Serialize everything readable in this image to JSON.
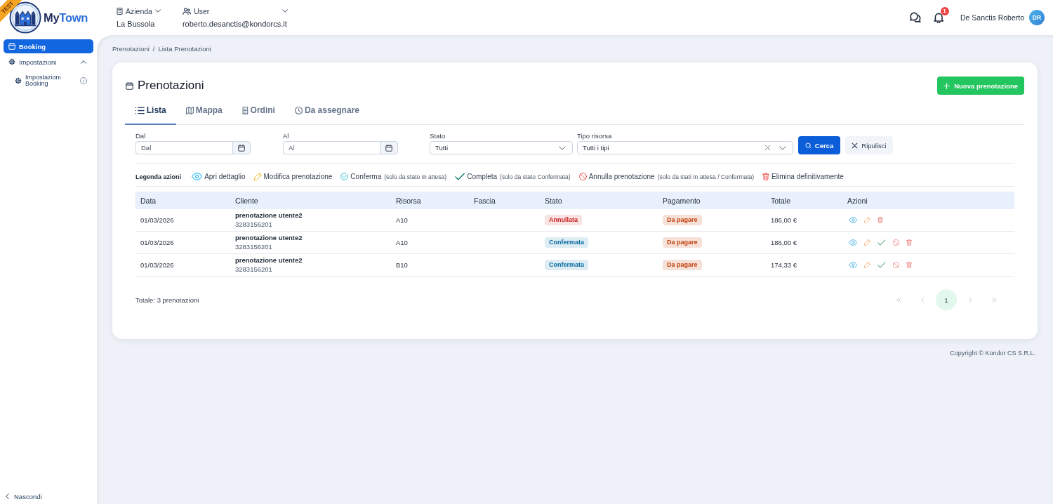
{
  "env_badge": "TEST",
  "logo": {
    "prefix": "My",
    "suffix": "Town"
  },
  "header": {
    "company": {
      "label": "Azienda",
      "value": "La Bussola"
    },
    "user": {
      "label": "User",
      "value": "roberto.desanctis@kondorcs.it"
    },
    "notifications": "1",
    "user_name": "De Sanctis Roberto",
    "avatar_initials": "DR"
  },
  "sidebar": {
    "items": [
      {
        "kind": "calendar",
        "label": "Booking",
        "selected": true
      },
      {
        "kind": "gear",
        "label": "Impostazioni",
        "selected": false,
        "expanded": true,
        "children": [
          {
            "kind": "gear",
            "label": "Impostazioni Booking",
            "selected": false,
            "info": true
          }
        ]
      }
    ],
    "hide_label": "Nascondi"
  },
  "breadcrumb": {
    "items": [
      "Prenotazioni",
      "Lista Prenotazioni"
    ],
    "separator": "/"
  },
  "page": {
    "title": "Prenotazioni",
    "new_button": "Nuova prenotazione",
    "tabs": [
      {
        "kind": "list",
        "label": "Lista",
        "selected": true
      },
      {
        "kind": "map",
        "label": "Mappa",
        "selected": false
      },
      {
        "kind": "receipt",
        "label": "Ordini",
        "selected": false
      },
      {
        "kind": "clock",
        "label": "Da assegnare",
        "selected": false
      }
    ],
    "filters": [
      {
        "kind": "date",
        "label": "Dal",
        "placeholder": "Dal"
      },
      {
        "kind": "date",
        "label": "Al",
        "placeholder": "Al"
      },
      {
        "kind": "select",
        "label": "Stato",
        "value": "Tutti"
      },
      {
        "kind": "select_clearable",
        "label": "Tipo risorsa",
        "value": "Tutti i tipi"
      }
    ],
    "search_button": "Cerca",
    "reset_button": "Ripulisci",
    "legend": {
      "title": "Legenda azioni",
      "items": [
        {
          "kind": "view",
          "label": "Apri dettaglio"
        },
        {
          "kind": "edit",
          "label": "Modifica prenotazione"
        },
        {
          "kind": "confirm",
          "label": "Conferma",
          "note": "(solo da stato In attesa)"
        },
        {
          "kind": "complete",
          "label": "Completa",
          "note": "(solo da stato Confermata)"
        },
        {
          "kind": "cancel",
          "label": "Annulla prenotazione",
          "note": "(solo da stati In attesa / Confermata)"
        },
        {
          "kind": "delete",
          "label": "Elimina definitivamente"
        }
      ]
    },
    "table": {
      "columns": [
        "Data",
        "Cliente",
        "Risorsa",
        "Fascia",
        "Stato",
        "Pagamento",
        "Totale",
        "Azioni"
      ],
      "rows": [
        {
          "date": "01/03/2026",
          "client": "prenotazione utente2",
          "phone": "3283156201",
          "resource": "A10",
          "status": {
            "text": "Annullata",
            "color": "#c81e1e"
          },
          "payment": {
            "text": "Da pagare",
            "color": "#c2410c"
          },
          "total": "186,00 €",
          "actions": [
            {
              "kind": "view"
            },
            {
              "kind": "edit"
            },
            {
              "kind": "delete"
            }
          ]
        },
        {
          "date": "01/03/2026",
          "client": "prenotazione utente2",
          "phone": "3283156201",
          "resource": "A10",
          "status": {
            "text": "Confermata",
            "color": "#0369a1"
          },
          "payment": {
            "text": "Da pagare",
            "color": "#c2410c"
          },
          "total": "186,00 €",
          "actions": [
            {
              "kind": "view"
            },
            {
              "kind": "edit"
            },
            {
              "kind": "complete"
            },
            {
              "kind": "cancel"
            },
            {
              "kind": "delete"
            }
          ]
        },
        {
          "date": "01/03/2026",
          "client": "prenotazione utente2",
          "phone": "3283156201",
          "resource": "B10",
          "status": {
            "text": "Confermata",
            "color": "#0369a1"
          },
          "payment": {
            "text": "Da pagare",
            "color": "#c2410c"
          },
          "total": "174,33 €",
          "actions": [
            {
              "kind": "view"
            },
            {
              "kind": "edit"
            },
            {
              "kind": "complete"
            },
            {
              "kind": "cancel"
            },
            {
              "kind": "delete"
            }
          ]
        }
      ]
    },
    "footer": {
      "total": "Totale: 3 prenotazioni",
      "pagination": [
        {
          "kind": "first",
          "selected": false
        },
        {
          "kind": "prev",
          "selected": false
        },
        {
          "kind": "page",
          "label": "1",
          "selected": true
        },
        {
          "kind": "next",
          "selected": false
        },
        {
          "kind": "last",
          "selected": false
        }
      ]
    }
  },
  "copyright": "Copyright © Kondor CS S.R.L."
}
